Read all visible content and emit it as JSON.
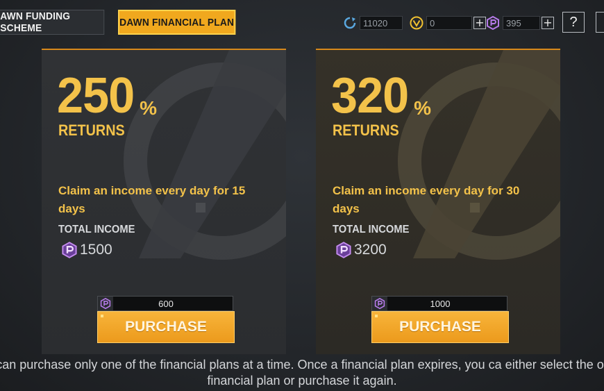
{
  "tabs": [
    {
      "label": "AWN FUNDING SCHEME"
    },
    {
      "label": "DAWN FINANCIAL PLAN"
    }
  ],
  "currencies": {
    "credits": {
      "icon": "refresh-credit-icon",
      "value": "11020",
      "color": "#5aa8e0"
    },
    "vcoin": {
      "icon": "v-coin-icon",
      "value": "0",
      "color": "#f2c230"
    },
    "premium": {
      "icon": "p-coin-icon",
      "value": "395",
      "color": "#b57ae8"
    }
  },
  "help_label": "?",
  "plans": [
    {
      "percent": "250",
      "percent_sign": "%",
      "returns_label": "RETURNS",
      "description": "Claim an income every day for 15 days",
      "total_income_label": "TOTAL INCOME",
      "total_income": "1500",
      "price": "600",
      "button_label": "PURCHASE"
    },
    {
      "percent": "320",
      "percent_sign": "%",
      "returns_label": "RETURNS",
      "description": "Claim an income every day for 30 days",
      "total_income_label": "TOTAL INCOME",
      "total_income": "3200",
      "price": "1000",
      "button_label": "PURCHASE"
    }
  ],
  "footer_text": "ou can purchase only one of the financial plans at a time. Once a financial plan expires, you ca either select the other financial plan or purchase it again.",
  "colors": {
    "accent": "#f3c24a",
    "button": "#f0a81e",
    "premium": "#b57ae8"
  }
}
